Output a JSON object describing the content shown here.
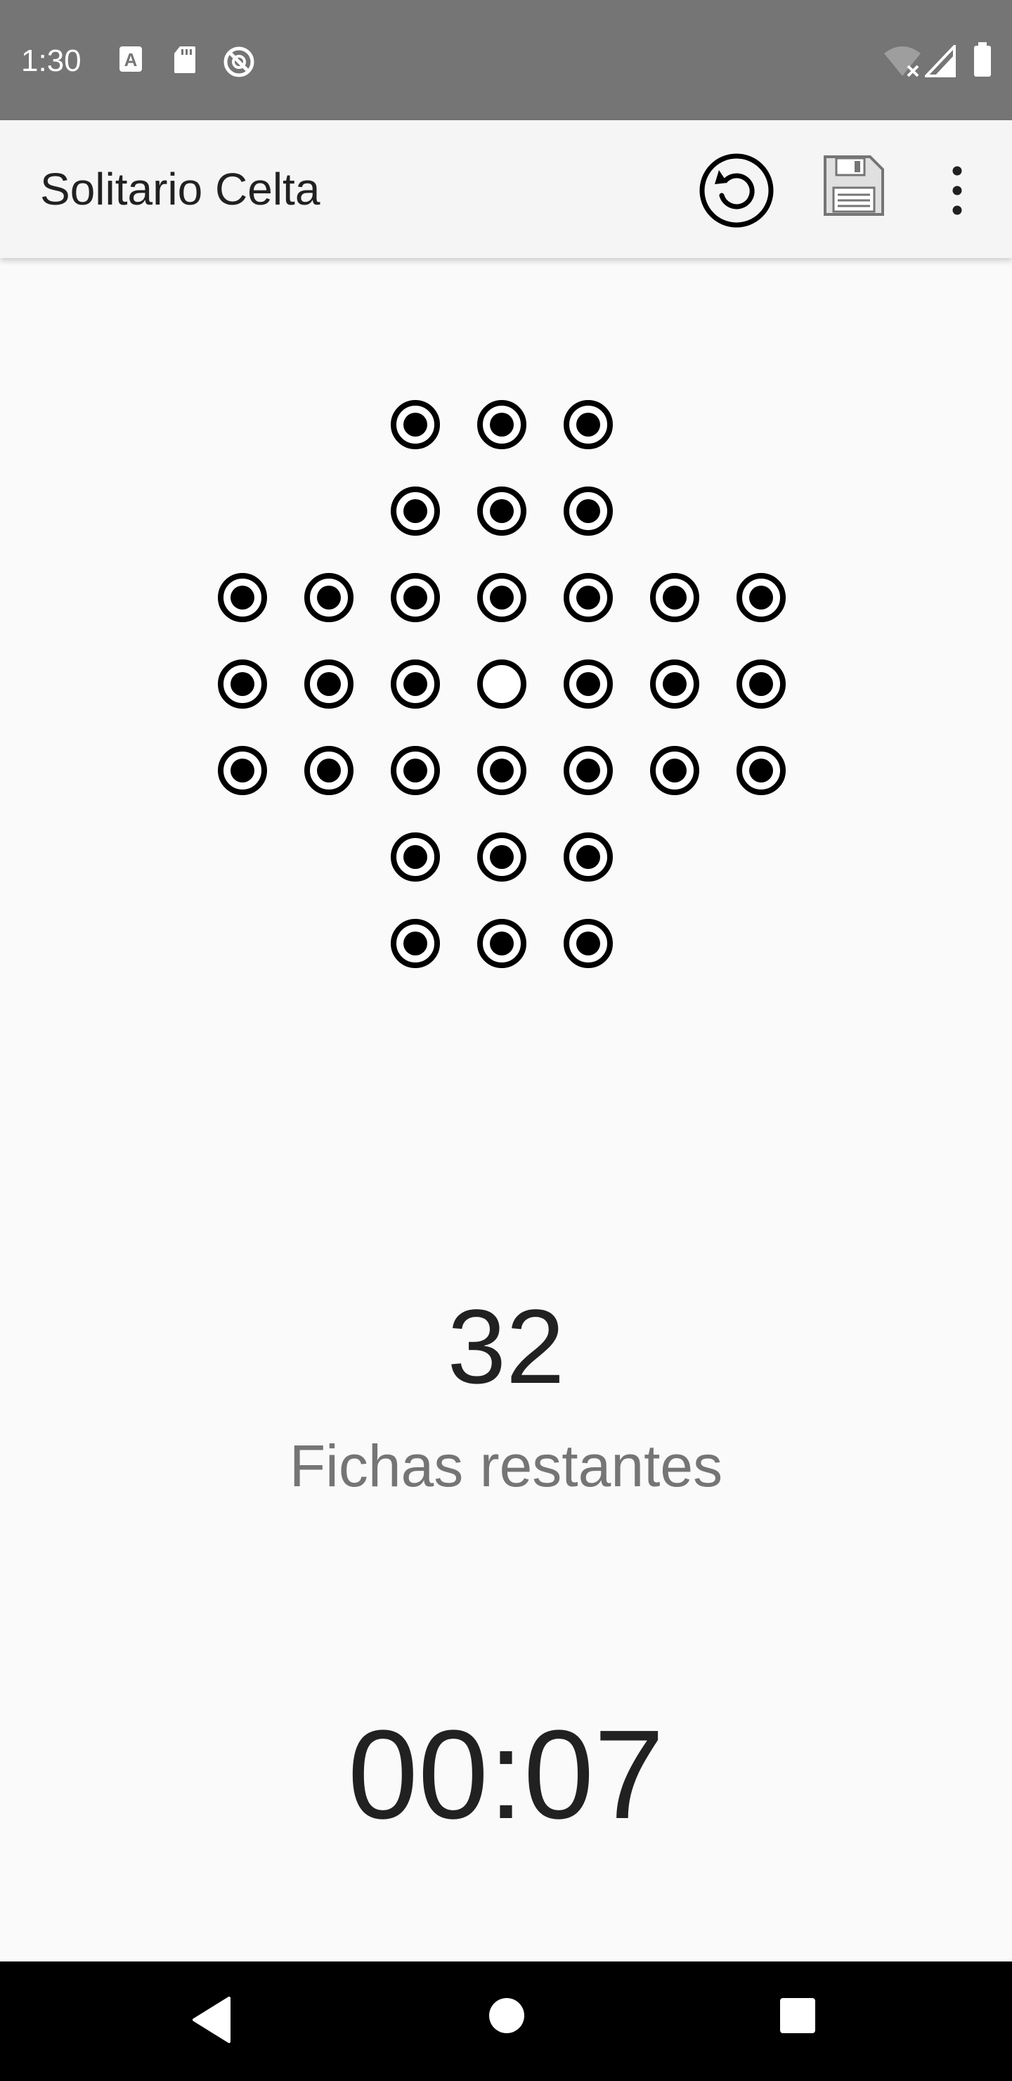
{
  "status_bar": {
    "time": "1:30",
    "icons": [
      "a-notification-icon",
      "sd-card-icon",
      "no-sync-icon",
      "wifi-off-icon",
      "signal-icon",
      "battery-icon"
    ]
  },
  "app_bar": {
    "title": "Solitario Celta",
    "actions": [
      "undo-icon",
      "save-icon",
      "more-vert-icon"
    ]
  },
  "board": {
    "rows": [
      "..OOO..",
      "..OOO..",
      "OOOOOOO",
      "OOO.OOO",
      "OOOOOOO",
      "..OOO..",
      "..OOO.."
    ],
    "legend": {
      "O": "peg",
      ".": "empty"
    }
  },
  "stats": {
    "remaining": "32",
    "remaining_label": "Fichas restantes",
    "timer": "00:07"
  },
  "colors": {
    "status_bar": "#757575",
    "app_bar": "#F5F5F5",
    "background": "#FAFAFA",
    "peg": "#000000",
    "label": "#757575",
    "nav_bar": "#000000"
  },
  "nav_bar": [
    "back-icon",
    "home-icon",
    "recents-icon"
  ]
}
